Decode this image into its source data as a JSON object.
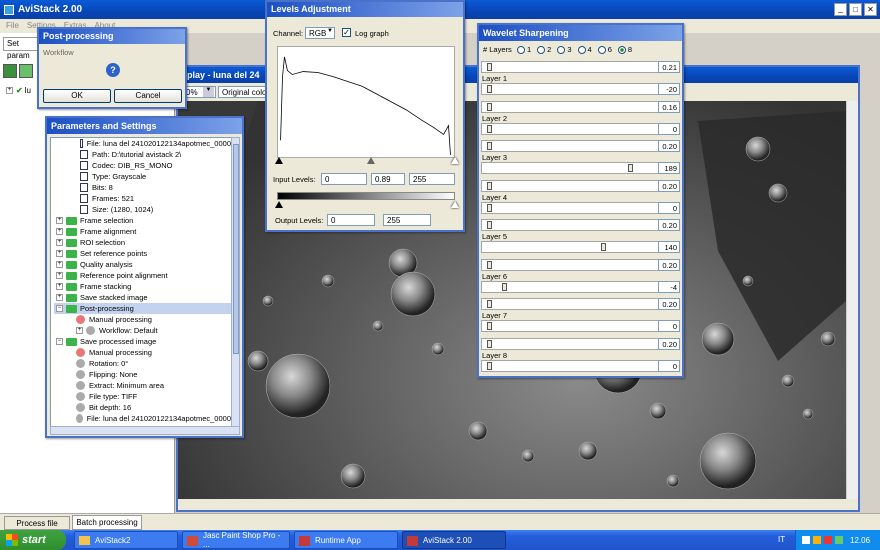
{
  "main_window": {
    "title": "AviStack 2.00",
    "menu": [
      "File",
      "Settings",
      "Extras",
      "About"
    ]
  },
  "toolbar_label": "Set param",
  "left_tree_item": "lu",
  "bottom_tabs": [
    "Process file",
    "Batch processing"
  ],
  "display": {
    "title": "splay - luna del 24",
    "zoom": "0%",
    "mode": "Original color"
  },
  "postproc": {
    "title": "Post-processing",
    "label": "Workflow",
    "ok": "OK",
    "cancel": "Cancel"
  },
  "params": {
    "title": "Parameters and Settings",
    "file_info": [
      "File: luna del 241020122134apotmec_0000",
      "Path: D:\\tutorial avistack 2\\",
      "Codec: DIB_RS_MONO",
      "Type: Grayscale",
      "Bits: 8",
      "Frames: 521",
      "Size: (1280, 1024)"
    ],
    "groups": [
      "Frame selection",
      "Frame alignment",
      "ROI selection",
      "Set reference points",
      "Quality analysis",
      "Reference point alignment",
      "Frame stacking",
      "Save stacked image",
      "Post-processing"
    ],
    "post_children": [
      "Manual processing",
      "Workflow: Default"
    ],
    "save_group": "Save processed image",
    "save_children": [
      "Manual processing",
      "Rotation: 0°",
      "Flipping: None",
      "Extract: Minimum area",
      "File type: TIFF",
      "Bit depth: 16",
      "File: luna del 241020122134apotmec_0000"
    ]
  },
  "levels": {
    "title": "Levels Adjustment",
    "channel_label": "Channel:",
    "channel_value": "RGB",
    "log_graph": "Log graph",
    "input_label": "Input Levels:",
    "input_values": [
      "0",
      "0.89",
      "255"
    ],
    "output_label": "Output Levels:",
    "output_values": [
      "0",
      "255"
    ]
  },
  "wavelet": {
    "title": "Wavelet Sharpening",
    "layers_label": "# Layers",
    "layer_options": [
      "1",
      "2",
      "3",
      "4",
      "6",
      "8"
    ],
    "selected_option": "8",
    "layers": [
      {
        "name": "Layer 1",
        "amount": "0.21",
        "value": "-20",
        "amount_pos": 0.03,
        "value_pos": 0.03
      },
      {
        "name": "Layer 2",
        "amount": "0.16",
        "value": "0",
        "amount_pos": 0.03,
        "value_pos": 0.03
      },
      {
        "name": "Layer 3",
        "amount": "0.20",
        "value": "189",
        "amount_pos": 0.03,
        "value_pos": 0.86
      },
      {
        "name": "Layer 4",
        "amount": "0.20",
        "value": "0",
        "amount_pos": 0.03,
        "value_pos": 0.03
      },
      {
        "name": "Layer 5",
        "amount": "0.20",
        "value": "140",
        "amount_pos": 0.03,
        "value_pos": 0.7
      },
      {
        "name": "Layer 6",
        "amount": "0.20",
        "value": "-4",
        "amount_pos": 0.03,
        "value_pos": 0.12
      },
      {
        "name": "Layer 7",
        "amount": "0.20",
        "value": "0",
        "amount_pos": 0.03,
        "value_pos": 0.03
      },
      {
        "name": "Layer 8",
        "amount": "0.20",
        "value": "0",
        "amount_pos": 0.03,
        "value_pos": 0.03
      }
    ]
  },
  "taskbar": {
    "start": "start",
    "items": [
      "AviStack2",
      "Jasc Paint Shop Pro - ...",
      "Runtime App",
      "AviStack 2.00"
    ],
    "lang": "IT",
    "clock": "12.06"
  }
}
